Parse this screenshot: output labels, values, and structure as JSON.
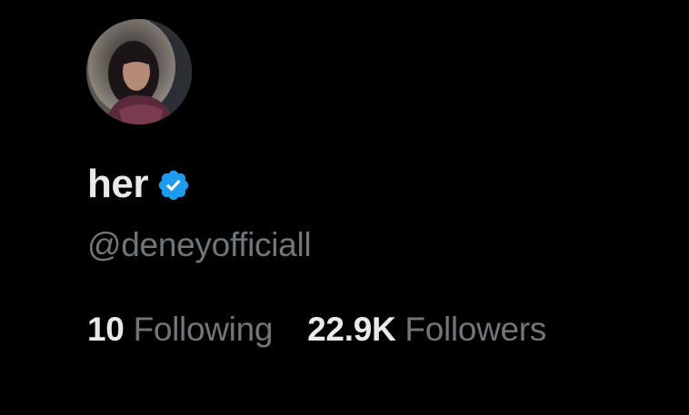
{
  "profile": {
    "display_name": "her",
    "handle": "@deneyofficiall",
    "verified_icon": "verified-badge-icon",
    "avatar_icon": "profile-photo",
    "accent_color": "#1d9bf0"
  },
  "stats": {
    "following_count": "10",
    "following_label": "Following",
    "followers_count": "22.9K",
    "followers_label": "Followers"
  }
}
